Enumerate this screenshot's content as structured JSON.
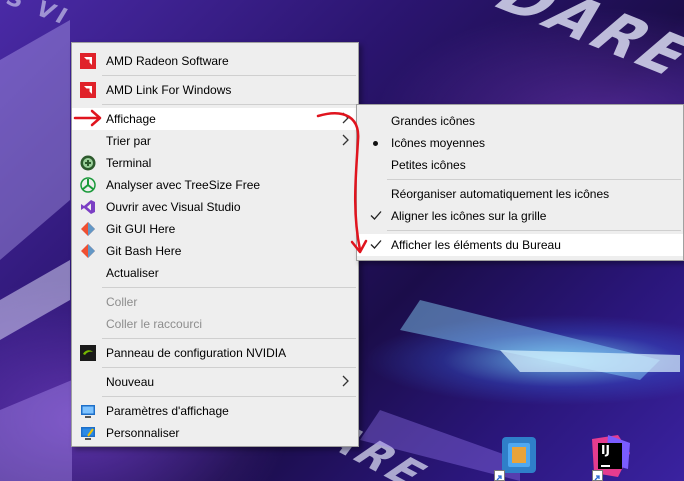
{
  "wallpaper": {
    "brand_fragment_top": "DARE",
    "brand_fragment_left": "S VI",
    "brand_fragment_bottom": "DARE"
  },
  "main_menu": {
    "items": [
      {
        "label": "AMD Radeon Software",
        "icon": "amd-icon"
      },
      {
        "label": "AMD Link For Windows",
        "icon": "amd-icon"
      },
      {
        "label": "Affichage",
        "has_submenu": true
      },
      {
        "label": "Trier par",
        "has_submenu": true
      },
      {
        "label": "Terminal",
        "icon": "terminal-icon"
      },
      {
        "label": "Analyser avec TreeSize Free",
        "icon": "treesize-icon"
      },
      {
        "label": "Ouvrir avec Visual Studio",
        "icon": "visual-studio-icon"
      },
      {
        "label": "Git GUI Here",
        "icon": "git-icon"
      },
      {
        "label": "Git Bash Here",
        "icon": "git-icon"
      },
      {
        "label": "Actualiser"
      },
      {
        "label": "Coller",
        "disabled": true
      },
      {
        "label": "Coller le raccourci",
        "disabled": true
      },
      {
        "label": "Panneau de configuration NVIDIA",
        "icon": "nvidia-icon"
      },
      {
        "label": "Nouveau",
        "has_submenu": true
      },
      {
        "label": "Paramètres d'affichage",
        "icon": "display-settings-icon"
      },
      {
        "label": "Personnaliser",
        "icon": "personalize-icon"
      }
    ]
  },
  "sub_menu": {
    "items": [
      {
        "label": "Grandes icônes"
      },
      {
        "label": "Icônes moyennes",
        "selected": true
      },
      {
        "label": "Petites icônes"
      },
      {
        "label": "Réorganiser automatiquement les icônes"
      },
      {
        "label": "Aligner les icônes sur la grille",
        "checked": true
      },
      {
        "label": "Afficher les éléments du Bureau",
        "checked": true
      }
    ]
  },
  "desktop_icons": {
    "intellij_text": "IJ"
  },
  "colors": {
    "menu_bg": "#eeeeee",
    "highlight": "#ffffff",
    "annotation_red": "#e0141e",
    "amd_red": "#e0222a"
  }
}
